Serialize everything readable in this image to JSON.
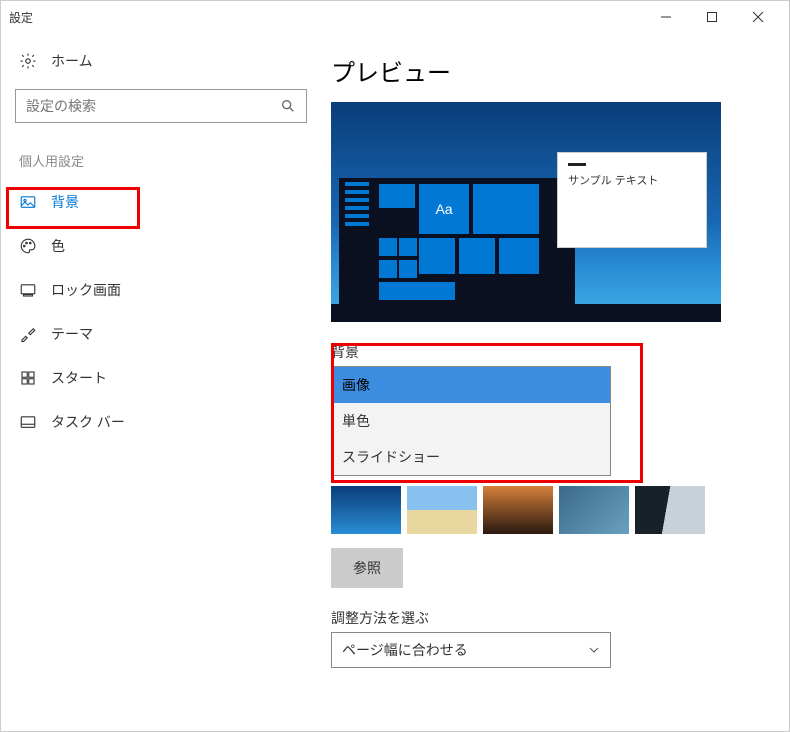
{
  "titlebar": {
    "title": "設定"
  },
  "sidebar": {
    "home": "ホーム",
    "search_placeholder": "設定の検索",
    "section": "個人用設定",
    "items": [
      {
        "label": "背景",
        "active": true
      },
      {
        "label": "色"
      },
      {
        "label": "ロック画面"
      },
      {
        "label": "テーマ"
      },
      {
        "label": "スタート"
      },
      {
        "label": "タスク バー"
      }
    ]
  },
  "content": {
    "preview_heading": "プレビュー",
    "preview_tile_text": "Aa",
    "preview_sample_text": "サンプル テキスト",
    "background_label": "背景",
    "background_options": [
      "画像",
      "単色",
      "スライドショー"
    ],
    "browse": "参照",
    "fit_label": "調整方法を選ぶ",
    "fit_value": "ページ幅に合わせる"
  }
}
